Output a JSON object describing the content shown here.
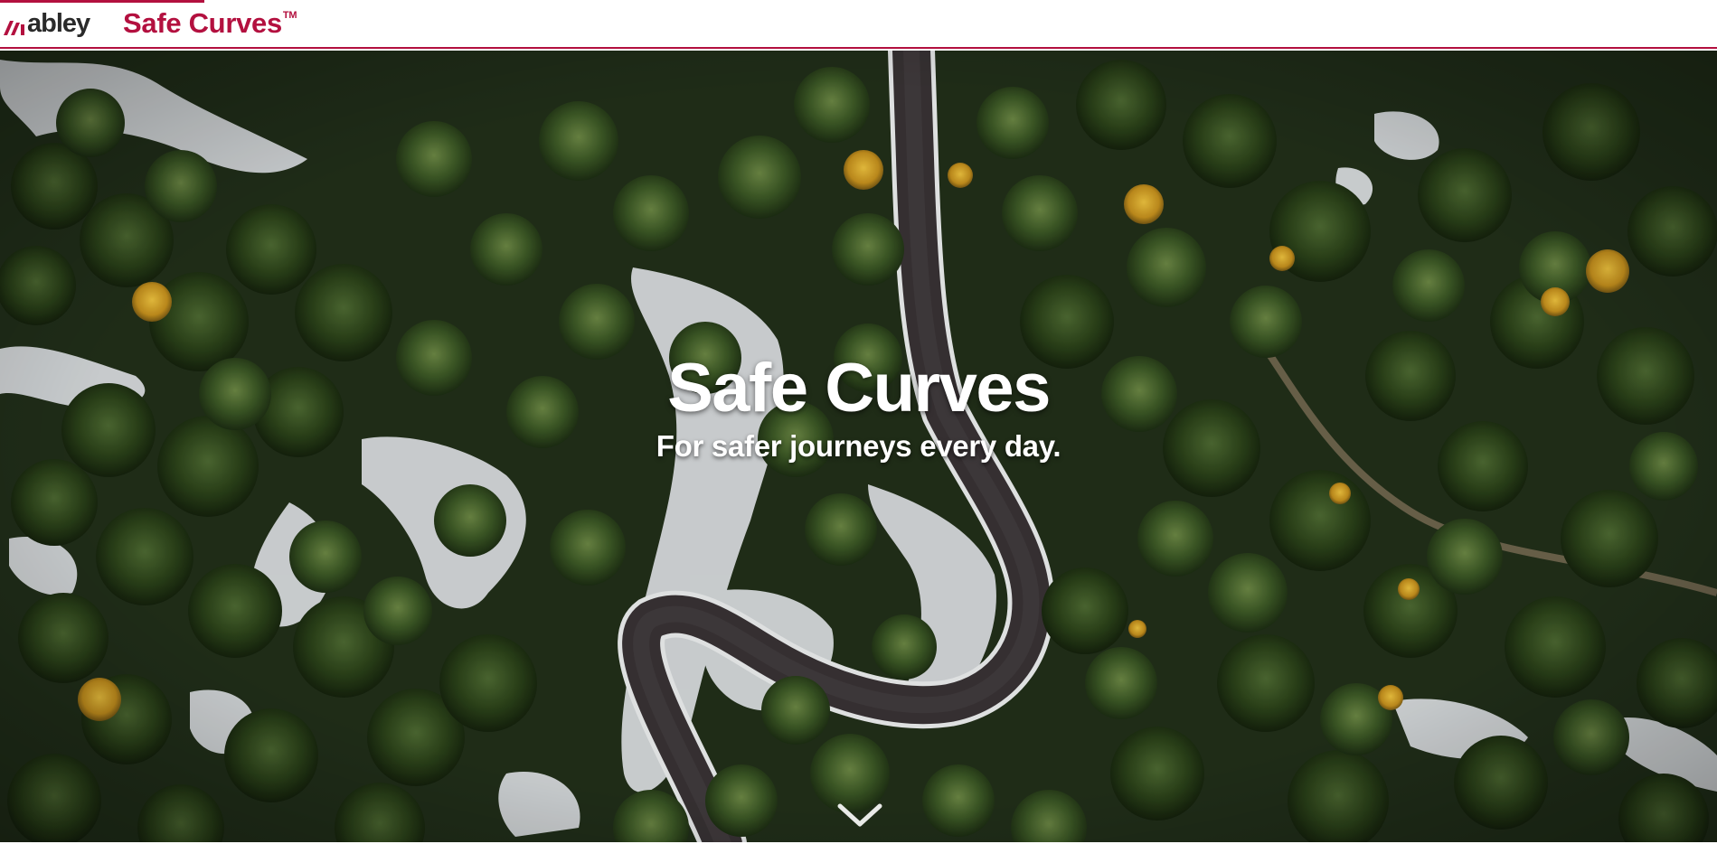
{
  "header": {
    "brand": {
      "logo_text": "abley",
      "icon": "abley-logo-mark-icon"
    },
    "product": {
      "name": "Safe Curves",
      "trademark": "TM"
    },
    "accent_color": "#b3103f"
  },
  "hero": {
    "background_image": "aerial view of a winding road through a forest",
    "title": "Safe Curves",
    "subtitle": "For safer journeys every day.",
    "scroll_icon": "chevron-down-icon"
  }
}
